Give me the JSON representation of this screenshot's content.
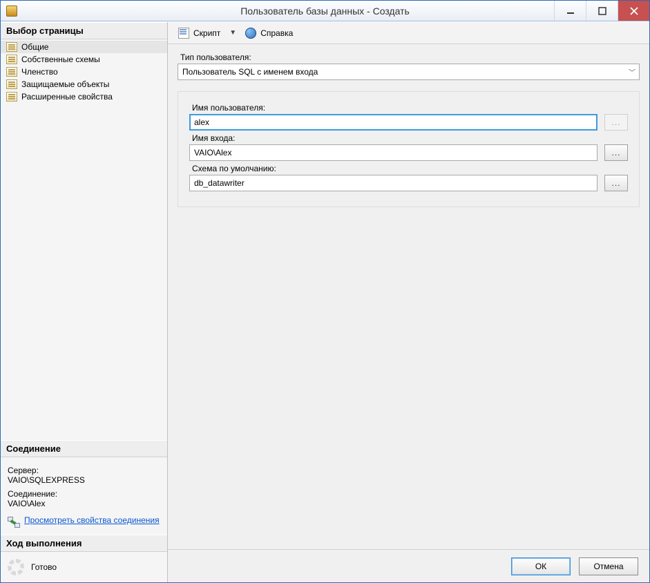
{
  "window": {
    "title": "Пользователь базы данных - Создать"
  },
  "sidebar": {
    "page_select_header": "Выбор страницы",
    "items": [
      {
        "label": "Общие"
      },
      {
        "label": "Собственные схемы"
      },
      {
        "label": "Членство"
      },
      {
        "label": "Защищаемые объекты"
      },
      {
        "label": "Расширенные свойства"
      }
    ],
    "connection_header": "Соединение",
    "server_label": "Сервер:",
    "server_value": "VAIO\\SQLEXPRESS",
    "connection_label": "Соединение:",
    "connection_value": "VAIO\\Alex",
    "view_props_link": "Просмотреть свойства соединения",
    "progress_header": "Ход выполнения",
    "progress_status": "Готово"
  },
  "toolbar": {
    "script_label": "Скрипт",
    "help_label": "Справка"
  },
  "form": {
    "user_type_label": "Тип пользователя:",
    "user_type_value": "Пользователь SQL с именем входа",
    "username_label": "Имя пользователя:",
    "username_value": "alex",
    "login_label": "Имя входа:",
    "login_value": "VAIO\\Alex",
    "schema_label": "Схема по умолчанию:",
    "schema_value": "db_datawriter",
    "browse": "..."
  },
  "footer": {
    "ok": "ОК",
    "cancel": "Отмена"
  }
}
